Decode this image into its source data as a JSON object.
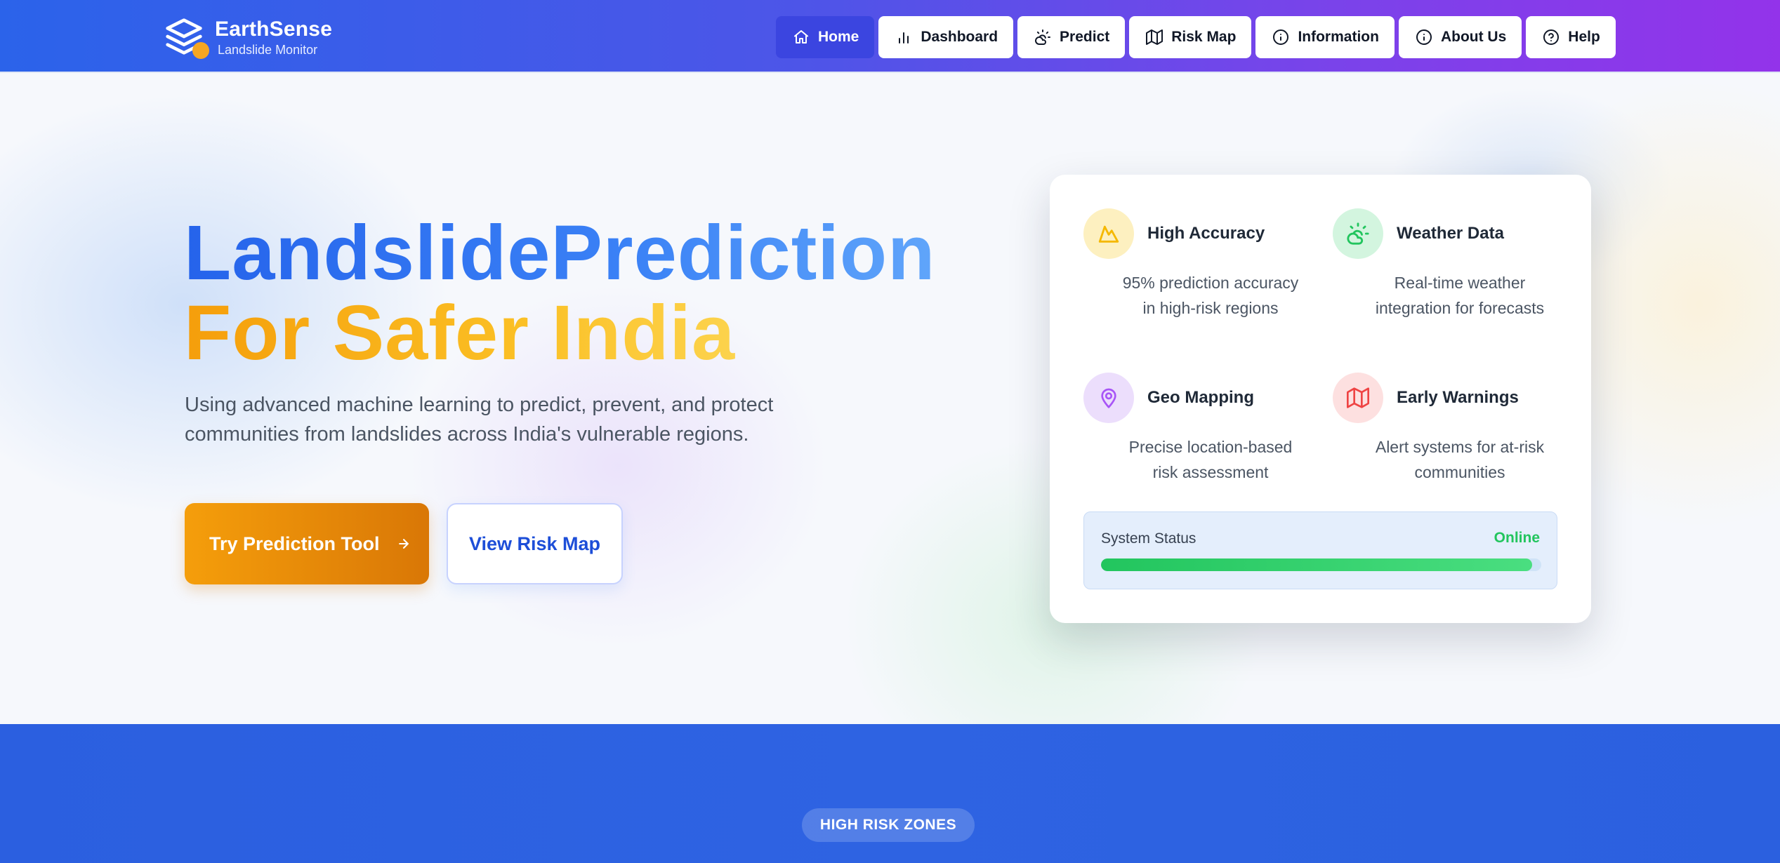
{
  "brand": {
    "name": "EarthSense",
    "tagline": "Landslide Monitor"
  },
  "nav": {
    "items": [
      {
        "label": "Home",
        "icon": "home-icon",
        "active": true
      },
      {
        "label": "Dashboard",
        "icon": "bar-chart-icon",
        "active": false
      },
      {
        "label": "Predict",
        "icon": "cloud-sun-icon",
        "active": false
      },
      {
        "label": "Risk Map",
        "icon": "map-icon",
        "active": false
      },
      {
        "label": "Information",
        "icon": "info-icon",
        "active": false
      },
      {
        "label": "About Us",
        "icon": "info-icon",
        "active": false
      },
      {
        "label": "Help",
        "icon": "help-circle-icon",
        "active": false
      }
    ]
  },
  "hero": {
    "title_part1": "Landslide",
    "title_part2": "Prediction",
    "title_line2": "For Safer India",
    "subtitle": "Using advanced machine learning to predict, prevent, and protect communities from landslides across India's vulnerable regions.",
    "primary_button": "Try Prediction Tool",
    "secondary_button": "View Risk Map"
  },
  "features": [
    {
      "title": "High Accuracy",
      "desc": "95% prediction accuracy in high-risk regions",
      "icon": "mountain-icon",
      "color": "#f5b800",
      "bg": "#fdf0c0"
    },
    {
      "title": "Weather Data",
      "desc": "Real-time weather integration for forecasts",
      "icon": "cloud-sun-icon",
      "color": "#22c55e",
      "bg": "#d3f5df"
    },
    {
      "title": "Geo Mapping",
      "desc": "Precise location-based risk assessment",
      "icon": "map-pin-icon",
      "color": "#a855f7",
      "bg": "#ecdefc"
    },
    {
      "title": "Early Warnings",
      "desc": "Alert systems for at-risk communities",
      "icon": "map-icon",
      "color": "#ef4444",
      "bg": "#fde0e0"
    }
  ],
  "system_status": {
    "label": "System Status",
    "value": "Online",
    "level": 0.98
  },
  "section2": {
    "badge": "HIGH RISK ZONES"
  },
  "colors": {
    "primary": "#2563eb",
    "accent": "#f59e0b",
    "nav_active": "#3b45e0",
    "online": "#22c55e"
  }
}
